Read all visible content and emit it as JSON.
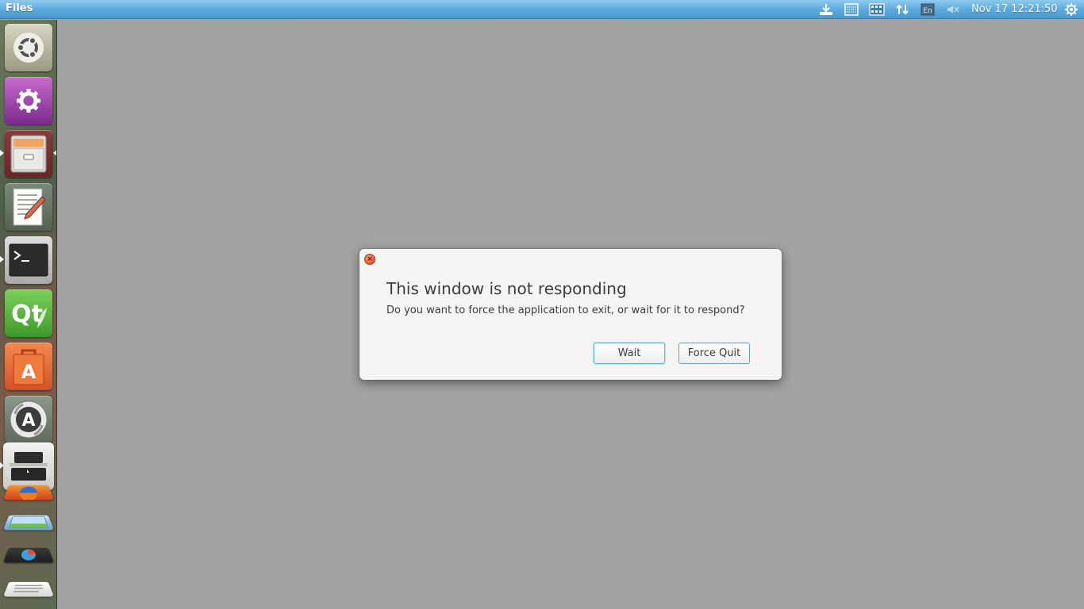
{
  "top_panel": {
    "app_title": "Files",
    "indicators": [
      "download-icon",
      "keyboard-icon",
      "calendar-icon",
      "network-icon",
      "keyboard-layout-icon",
      "volume-mute-icon"
    ],
    "clock": "Nov 17 12:21:50",
    "settings_icon": "gear-icon"
  },
  "launcher": {
    "items": [
      {
        "name": "dash-home",
        "icon": "ubuntu-logo-icon",
        "running": false
      },
      {
        "name": "system-settings",
        "icon": "gear-icon",
        "running": false
      },
      {
        "name": "files",
        "icon": "file-cabinet-icon",
        "running": true
      },
      {
        "name": "text-editor",
        "icon": "notepad-pen-icon",
        "running": false
      },
      {
        "name": "terminal",
        "icon": "terminal-icon",
        "running": true
      },
      {
        "name": "qt-creator",
        "icon": "qt-icon",
        "running": false
      },
      {
        "name": "software-center",
        "icon": "shopping-bag-icon",
        "running": false
      },
      {
        "name": "software-updater",
        "icon": "updater-icon",
        "running": false
      },
      {
        "name": "scanner",
        "icon": "scanner-icon",
        "running": true
      }
    ],
    "stacked_items": [
      "firefox-icon",
      "image-viewer-icon",
      "impress-icon",
      "writer-icon"
    ]
  },
  "dialog": {
    "title": "This window is not responding",
    "message": "Do you want to force the application to exit, or wait for it to respond?",
    "wait_label": "Wait",
    "force_quit_label": "Force Quit",
    "close_symbol": "×"
  },
  "colors": {
    "desktop_bg": "#a3a3a3",
    "panel": "#5aa9dd",
    "dialog_bg": "#f5f4f2",
    "close_button": "#e25a2e"
  }
}
